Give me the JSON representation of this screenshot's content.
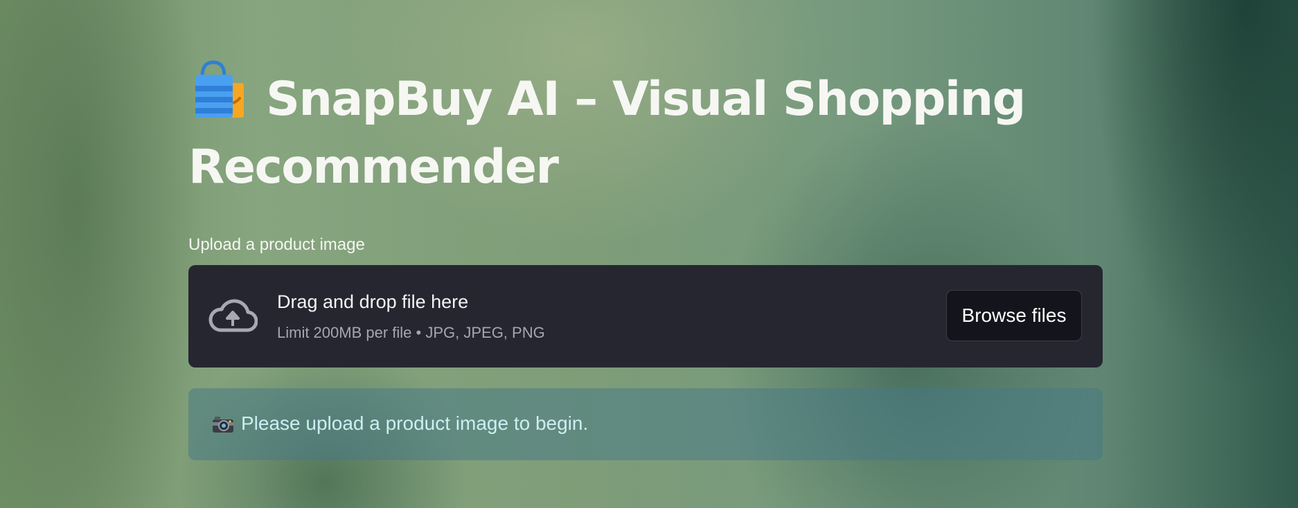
{
  "header": {
    "title_icon": "shopping-bags-icon",
    "title": "SnapBuy AI – Visual Shopping Recommender"
  },
  "uploader": {
    "label": "Upload a product image",
    "icon": "cloud-upload-icon",
    "dropzone_title": "Drag and drop file here",
    "dropzone_subtitle": "Limit 200MB per file • JPG, JPEG, PNG",
    "browse_label": "Browse files"
  },
  "info": {
    "icon": "camera-icon",
    "message": "Please upload a product image to begin."
  },
  "colors": {
    "dropzone_bg": "#262631",
    "button_bg": "#14151c",
    "info_bg": "#46788a",
    "info_text": "#cdeef2",
    "title_text": "#f6f7f3"
  }
}
